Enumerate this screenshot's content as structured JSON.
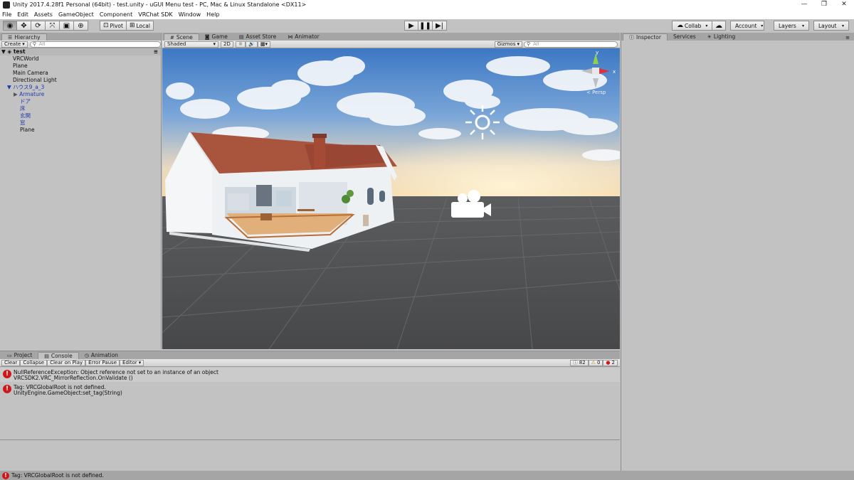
{
  "window": {
    "title": "Unity 2017.4.28f1 Personal (64bit) - test.unity - uGUI Menu test - PC, Mac & Linux Standalone <DX11>",
    "controls": [
      "—",
      "❐",
      "✕"
    ]
  },
  "menu": [
    "File",
    "Edit",
    "Assets",
    "GameObject",
    "Component",
    "VRChat SDK",
    "Window",
    "Help"
  ],
  "toolbar": {
    "pivot_label": "Pivot",
    "local_label": "Local",
    "collab_label": "Collab",
    "account_label": "Account",
    "layers_label": "Layers",
    "layout_label": "Layout"
  },
  "hierarchy": {
    "tab": "Hierarchy",
    "create_label": "Create",
    "search_placeholder": "All",
    "scene_name": "test",
    "items": [
      {
        "label": "VRCWorld"
      },
      {
        "label": "Plane"
      },
      {
        "label": "Main Camera"
      },
      {
        "label": "Directional Light"
      },
      {
        "label": "ハウス9_a_3"
      },
      {
        "label": "Armature"
      },
      {
        "label": "ドア"
      },
      {
        "label": "床"
      },
      {
        "label": "玄関"
      },
      {
        "label": "窓"
      },
      {
        "label": "Plane"
      }
    ]
  },
  "scene": {
    "tabs": [
      "Scene",
      "Game",
      "Asset Store",
      "Animator"
    ],
    "shading_mode": "Shaded",
    "mode_2d": "2D",
    "gizmos_label": "Gizmos",
    "search_placeholder": "All",
    "persp_label": "< Persp"
  },
  "inspector": {
    "tabs": [
      "Inspector",
      "Services",
      "Lighting"
    ]
  },
  "console": {
    "tabs": [
      "Project",
      "Console",
      "Animation"
    ],
    "buttons": {
      "clear": "Clear",
      "collapse": "Collapse",
      "clear_on_play": "Clear on Play",
      "error_pause": "Error Pause",
      "editor": "Editor"
    },
    "counts": {
      "info": "82",
      "warning": "0",
      "error": "2"
    },
    "entries": [
      {
        "line1": "NullReferenceException: Object reference not set to an instance of an object",
        "line2": "VRCSDK2.VRC_MirrorReflection.OnValidate ()"
      },
      {
        "line1": "Tag: VRCGlobalRoot is not defined.",
        "line2": "UnityEngine.GameObject:set_tag(String)"
      }
    ]
  },
  "status": {
    "message": "Tag: VRCGlobalRoot is not defined."
  }
}
